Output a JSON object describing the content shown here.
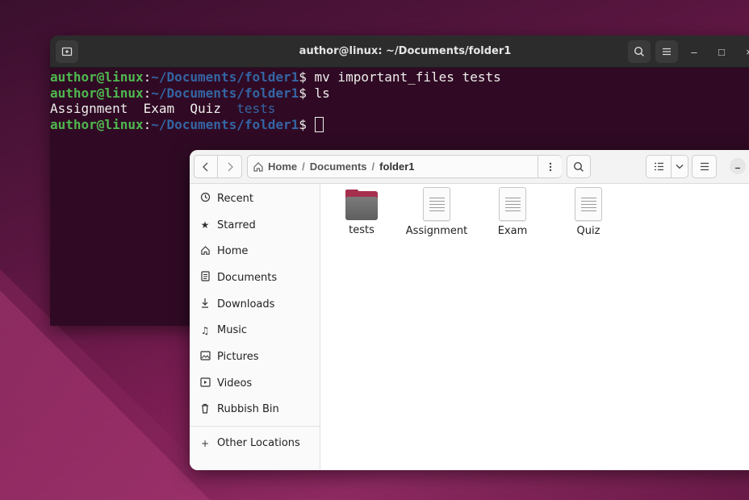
{
  "terminal": {
    "title": "author@linux: ~/Documents/folder1",
    "prompt_user": "author@linux",
    "prompt_sep": ":",
    "prompt_path": "~/Documents/folder1",
    "prompt_end": "$ ",
    "cmd1": "mv important_files tests",
    "cmd2": "ls",
    "ls_files": [
      "Assignment",
      "Exam",
      "Quiz"
    ],
    "ls_dir": "tests",
    "buttons": {
      "minimize": "–",
      "maximize": "□",
      "close": "×"
    }
  },
  "files": {
    "path": {
      "home": "Home",
      "sep": "/",
      "documents": "Documents",
      "current": "folder1"
    },
    "sidebar": {
      "items": [
        {
          "label": "Recent",
          "icon": "clock-icon"
        },
        {
          "label": "Starred",
          "icon": "star-icon"
        },
        {
          "label": "Home",
          "icon": "home-icon"
        },
        {
          "label": "Documents",
          "icon": "document-icon"
        },
        {
          "label": "Downloads",
          "icon": "download-icon"
        },
        {
          "label": "Music",
          "icon": "music-icon"
        },
        {
          "label": "Pictures",
          "icon": "picture-icon"
        },
        {
          "label": "Videos",
          "icon": "video-icon"
        },
        {
          "label": "Rubbish Bin",
          "icon": "trash-icon"
        }
      ],
      "other": "Other Locations"
    },
    "items": [
      {
        "name": "tests",
        "type": "folder"
      },
      {
        "name": "Assignment",
        "type": "file"
      },
      {
        "name": "Exam",
        "type": "file"
      },
      {
        "name": "Quiz",
        "type": "file"
      }
    ],
    "colors": {
      "folder_accent": "#a4304e",
      "terminal_bg": "#300a24",
      "prompt_user": "#4fb84f",
      "prompt_path": "#3465a4"
    }
  }
}
